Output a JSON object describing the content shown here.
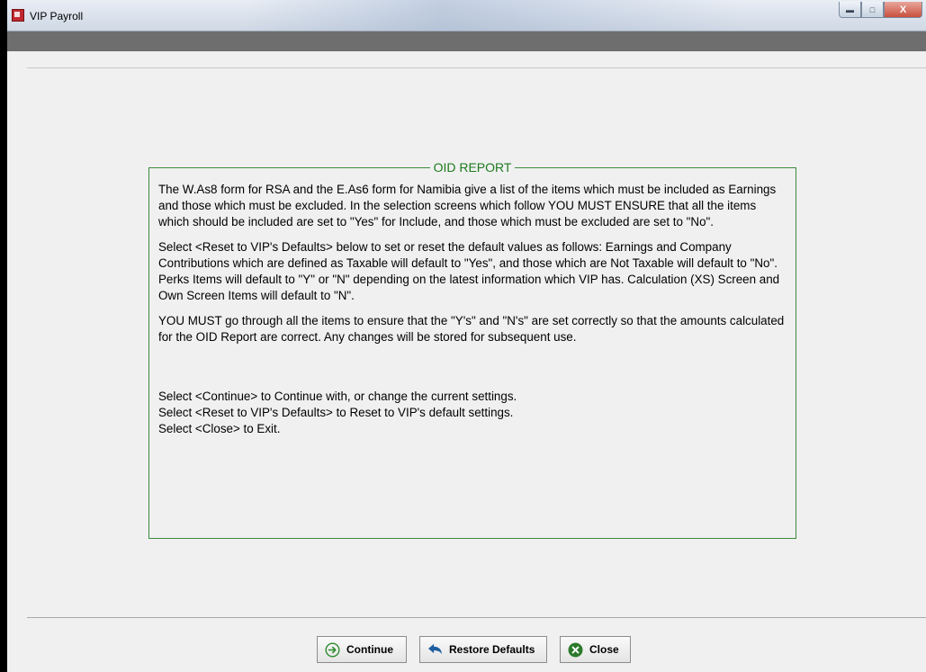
{
  "window": {
    "title": "VIP Payroll",
    "controls": {
      "minimize": "▬",
      "maximize": "□",
      "close": "X"
    }
  },
  "report": {
    "legend": "OID REPORT",
    "paragraphs": [
      "The W.As8 form for RSA and the E.As6 form for Namibia give a list of the items which must be included as Earnings and those which must be excluded.  In the selection screens which follow YOU MUST ENSURE that all the items which should be included are set to \"Yes\" for Include, and those which must be excluded are set to \"No\".",
      "Select <Reset to VIP's Defaults> below to set or reset the default values as follows:  Earnings and Company Contributions which are defined as Taxable will default to \"Yes\", and those which are Not Taxable will default to \"No\".  Perks Items will default to \"Y\" or \"N\" depending on the latest information which VIP has.  Calculation (XS) Screen and Own Screen Items will default to \"N\".",
      "YOU MUST go through all the items to ensure that the \"Y's\" and \"N's\" are set correctly so that the amounts calculated for the OID Report are correct.  Any changes will be stored for subsequent use."
    ],
    "selections": [
      "Select <Continue> to Continue with, or change the current settings.",
      "Select <Reset to VIP's Defaults> to Reset to VIP's default settings.",
      "Select <Close> to Exit."
    ]
  },
  "buttons": {
    "continue": {
      "label": "Continue",
      "icon": "arrow-right-circle-icon"
    },
    "restore": {
      "label": "Restore Defaults",
      "icon": "undo-arrow-icon"
    },
    "close": {
      "label": "Close",
      "icon": "close-circle-icon"
    }
  },
  "colors": {
    "legend": "#1e7a1e",
    "fieldset_border": "#3a8a3a",
    "continue_icon": "#2e8b2e",
    "restore_icon": "#1f5f9f",
    "close_icon": "#2b7a2b"
  }
}
